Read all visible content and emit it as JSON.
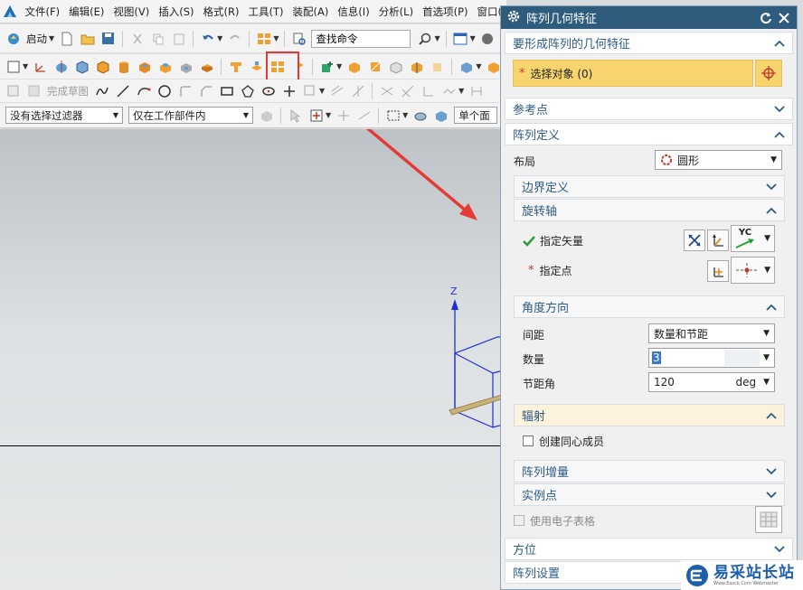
{
  "menubar": {
    "items": [
      "文件(F)",
      "编辑(E)",
      "视图(V)",
      "插入(S)",
      "格式(R)",
      "工具(T)",
      "装配(A)",
      "信息(I)",
      "分析(L)",
      "首选项(P)",
      "窗口("
    ]
  },
  "toolbar": {
    "start_label": "启动",
    "search_value": "查找命令",
    "finish_sketch_label": "完成草图",
    "filter_value": "没有选择过滤器",
    "scope_value": "仅在工作部件内",
    "face_rule_value": "单个面"
  },
  "graphics": {
    "axis_z_label": "Z"
  },
  "dialog": {
    "title": "阵列几何特征",
    "sections": {
      "geometry": {
        "header": "要形成阵列的几何特征",
        "select_label": "选择对象 (0)"
      },
      "reference_point": {
        "header": "参考点"
      },
      "pattern_definition": {
        "header": "阵列定义",
        "layout_label": "布局",
        "layout_value": "圆形",
        "boundary_header": "边界定义",
        "rotation_axis_header": "旋转轴",
        "specify_vector_label": "指定矢量",
        "vector_button_label": "YC",
        "specify_point_label": "指定点",
        "angle_direction_header": "角度方向",
        "spacing_label": "间距",
        "spacing_value": "数量和节距",
        "count_label": "数量",
        "count_value": "3",
        "pitch_angle_label": "节距角",
        "pitch_angle_value": "120",
        "pitch_angle_unit": "deg",
        "radiate_header": "辐射",
        "concentric_label": "创建同心成员",
        "pattern_increment_header": "阵列增量",
        "instance_points_header": "实例点",
        "spreadsheet_label": "使用电子表格"
      },
      "orientation": {
        "header": "方位"
      },
      "pattern_settings": {
        "header": "阵列设置"
      }
    }
  },
  "watermark": {
    "text": "易采站长站",
    "small": "Www.Easck.Com  Webmaster"
  },
  "colors": {
    "title_bar": "#2f5c7d",
    "section_text": "#2d5b85",
    "selection_bar": "#f7d46e",
    "highlight_box": "#e53935",
    "arrow": "#e53935"
  }
}
